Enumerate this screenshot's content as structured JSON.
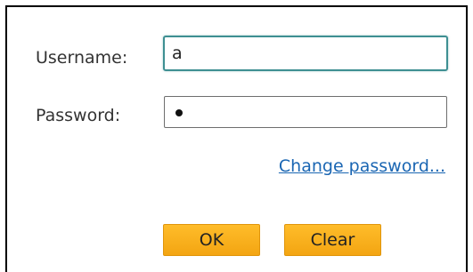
{
  "login": {
    "username_label": "Username:",
    "username_value": "a",
    "password_label": "Password:",
    "password_value_masked": "•",
    "change_password_link": "Change password...",
    "ok_label": "OK",
    "clear_label": "Clear"
  },
  "colors": {
    "button_fill": "#f7ad18",
    "link": "#1a66b3",
    "focused_border": "#3e8f92"
  }
}
